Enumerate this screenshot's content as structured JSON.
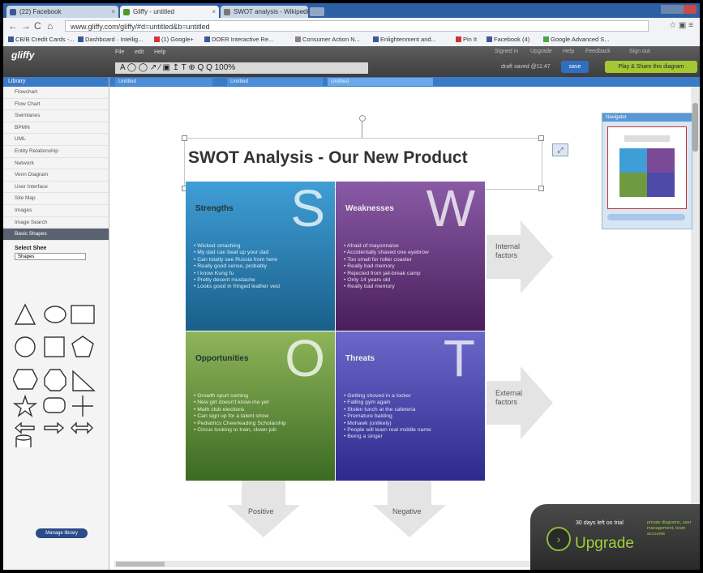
{
  "browser": {
    "tabs": [
      {
        "label": "(22) Facebook"
      },
      {
        "label": "Gliffy - untitled"
      },
      {
        "label": "SWOT analysis - Wikipedia..."
      }
    ],
    "url": "www.gliffy.com/gliffy/#d=untitled&b=untitled",
    "bookmarks": [
      "CB/B Credit Cards -...",
      "Dashboard · Intellig...",
      "(1) Google+",
      "DOER Interactive Re...",
      "Consumer Action N...",
      "Enlightenment and...",
      "Pin It",
      "Facebook (4)",
      "Google Advanced S..."
    ]
  },
  "gliffy": {
    "logo": "gliffy",
    "menus": [
      "File",
      "edit",
      "Help"
    ],
    "tools": "A ◯ ◯ ↗ ∕ ▣   ↥ T   ⊕ Q Q   100%",
    "saved_text": "draft saved @11:47",
    "save_label": "save",
    "share_label": "Play & Share this diagram",
    "header_links": [
      "Signed in",
      "Upgrade",
      "Help",
      "Feedback",
      "Sign out"
    ]
  },
  "doc_tabs": [
    "Untitled",
    "Untitled",
    "Untitled"
  ],
  "sidebar": {
    "header": "Library",
    "items": [
      "Flowchart",
      "Flow Chart",
      "Swimlanes",
      "BPMN",
      "UML",
      "Entity Relationship",
      "Network",
      "Venn Diagram",
      "User Interface",
      "Site Map",
      "Images",
      "Image Search",
      "Basic Shapes"
    ],
    "selected_index": 12,
    "shapes_title": "Select Shee",
    "shapes_select": "Shapes",
    "manage_label": "Manage library"
  },
  "diagram": {
    "title": "SWOT Analysis - Our New Product",
    "quadrants": [
      {
        "key": "s",
        "letter": "S",
        "heading": "Strengths",
        "items": [
          "Wicked smashing",
          "My dad can beat up your dad",
          "Can totally see Russia from here",
          "Really good sense, probably",
          "I know Kung fu",
          "Pretty decent mustache",
          "Looks good in fringed leather vest"
        ]
      },
      {
        "key": "w",
        "letter": "W",
        "heading": "Weaknesses",
        "items": [
          "Afraid of mayonnaise",
          "Accidentally shaved one eyebrow",
          "Too small for roller coaster",
          "Really bad memory",
          "Rejected from jail-break camp",
          "Only 14 years old",
          "Really bad memory"
        ]
      },
      {
        "key": "o",
        "letter": "O",
        "heading": "Opportunities",
        "items": [
          "Growth spurt coming",
          "New girl doesn't know me yet",
          "Math club elections",
          "Can sign up for a talent show",
          "Pediatrics Cheerleading Scholarship",
          "Circus looking to train, clown job"
        ]
      },
      {
        "key": "t",
        "letter": "T",
        "heading": "Threats",
        "items": [
          "Getting shoved in a locker",
          "Falling gym again",
          "Stolen lunch at the cafeteria",
          "Premature balding",
          "Mohawk (unlikely)",
          "People will learn real middle name",
          "Being a singer"
        ]
      }
    ],
    "internal_label": "Internal factors",
    "external_label": "External factors",
    "positive_label": "Positive",
    "negative_label": "Negative"
  },
  "navigator": {
    "title": "Navigator"
  },
  "upgrade": {
    "days": "30 days left on trial",
    "word": "Upgrade",
    "small": "private diagrams, user management, team accounts"
  }
}
